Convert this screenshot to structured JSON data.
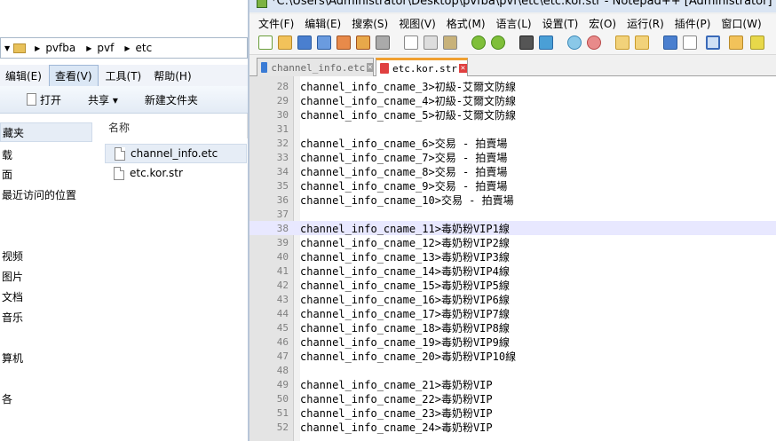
{
  "explorer": {
    "breadcrumb": [
      "pvfba",
      "pvf",
      "etc"
    ],
    "menu": [
      "编辑(E)",
      "查看(V)",
      "工具(T)",
      "帮助(H)"
    ],
    "toolbar": {
      "open": "打开",
      "share": "共享 ▾",
      "new_folder": "新建文件夹"
    },
    "nav_items": [
      "藏夹",
      "载",
      "面",
      "最近访问的位置",
      "视频",
      "图片",
      "文档",
      "音乐",
      "算机",
      "各"
    ],
    "column_header": "名称",
    "files": [
      "channel_info.etc",
      "etc.kor.str"
    ]
  },
  "notepad": {
    "title": "*C:\\Users\\Administrator\\Desktop\\pvfba\\pvf\\etc\\etc.kor.str - Notepad++ [Administrator]",
    "menu": [
      "文件(F)",
      "编辑(E)",
      "搜索(S)",
      "视图(V)",
      "格式(M)",
      "语言(L)",
      "设置(T)",
      "宏(O)",
      "运行(R)",
      "插件(P)",
      "窗口(W)"
    ],
    "tabs": [
      "channel_info.etc",
      "etc.kor.str"
    ],
    "active_tab": 1,
    "current_line": 38,
    "lines": [
      {
        "n": "28",
        "t": "channel_info_cname_3>初級-艾爾文防線"
      },
      {
        "n": "29",
        "t": "channel_info_cname_4>初級-艾爾文防線"
      },
      {
        "n": "30",
        "t": "channel_info_cname_5>初級-艾爾文防線"
      },
      {
        "n": "31",
        "t": ""
      },
      {
        "n": "32",
        "t": "channel_info_cname_6>交易 - 拍賣場"
      },
      {
        "n": "33",
        "t": "channel_info_cname_7>交易 - 拍賣場"
      },
      {
        "n": "34",
        "t": "channel_info_cname_8>交易 - 拍賣場"
      },
      {
        "n": "35",
        "t": "channel_info_cname_9>交易 - 拍賣場"
      },
      {
        "n": "36",
        "t": "channel_info_cname_10>交易 - 拍賣場"
      },
      {
        "n": "37",
        "t": ""
      },
      {
        "n": "38",
        "t": "channel_info_cname_11>毒奶粉VIP1線"
      },
      {
        "n": "39",
        "t": "channel_info_cname_12>毒奶粉VIP2線"
      },
      {
        "n": "40",
        "t": "channel_info_cname_13>毒奶粉VIP3線"
      },
      {
        "n": "41",
        "t": "channel_info_cname_14>毒奶粉VIP4線"
      },
      {
        "n": "42",
        "t": "channel_info_cname_15>毒奶粉VIP5線"
      },
      {
        "n": "43",
        "t": "channel_info_cname_16>毒奶粉VIP6線"
      },
      {
        "n": "44",
        "t": "channel_info_cname_17>毒奶粉VIP7線"
      },
      {
        "n": "45",
        "t": "channel_info_cname_18>毒奶粉VIP8線"
      },
      {
        "n": "46",
        "t": "channel_info_cname_19>毒奶粉VIP9線"
      },
      {
        "n": "47",
        "t": "channel_info_cname_20>毒奶粉VIP10線"
      },
      {
        "n": "48",
        "t": ""
      },
      {
        "n": "49",
        "t": "channel_info_cname_21>毒奶粉VIP"
      },
      {
        "n": "50",
        "t": "channel_info_cname_22>毒奶粉VIP"
      },
      {
        "n": "51",
        "t": "channel_info_cname_23>毒奶粉VIP"
      },
      {
        "n": "52",
        "t": "channel_info_cname_24>毒奶粉VIP"
      }
    ]
  },
  "colors": {
    "current_line": "#e8e8ff",
    "tab_close": "#e04040",
    "tab_save_modified": "#e04040",
    "tab_save_clean": "#3a7bd5"
  },
  "icons": [
    "new-file-icon",
    "open-file-icon",
    "save-icon",
    "save-all-icon",
    "close-icon",
    "close-all-icon",
    "print-icon",
    "cut-icon",
    "copy-icon",
    "paste-icon",
    "undo-icon",
    "redo-icon",
    "find-icon",
    "replace-icon",
    "zoom-in-icon",
    "zoom-out-icon",
    "sync-v-icon",
    "sync-h-icon",
    "word-wrap-icon",
    "show-all-icon",
    "indent-guide-icon",
    "doc-map-icon"
  ]
}
